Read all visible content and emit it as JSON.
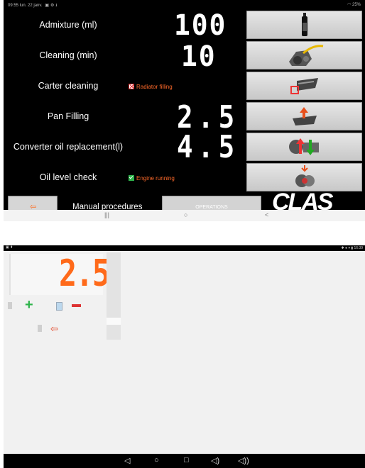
{
  "top_status": {
    "time_date": "09:55 lun. 22 janv.",
    "icons": [
      "image-icon",
      "gear-icon",
      "download-icon"
    ],
    "right": "25%"
  },
  "rows": [
    {
      "label": "Admixture (ml)",
      "value": "100"
    },
    {
      "label": "Cleaning (min)",
      "value": "10"
    },
    {
      "label": "Carter cleaning",
      "value": ""
    },
    {
      "label": "Pan Filling",
      "value": "2.5"
    },
    {
      "label": "Converter oil replacement(l)",
      "value": "4.5"
    },
    {
      "label": "Oil level check",
      "value": ""
    }
  ],
  "options": {
    "radiator": "Radiator filling",
    "engine": "Engine running"
  },
  "bottom_bar": {
    "manual": "Manual procedures",
    "operations": "OPERATIONS",
    "logo": "CLAS"
  },
  "nav": {
    "recents": "|||",
    "home": "○",
    "back": "<"
  },
  "bottom_screen": {
    "value": "2.5",
    "status_right": "16:39",
    "nav": {
      "back": "◁",
      "home": "○",
      "recents": "□",
      "vol_down": "◁)",
      "vol_up": "◁))"
    }
  },
  "colors": {
    "accent": "#ff6a1a",
    "screen_bg": "#000000"
  }
}
